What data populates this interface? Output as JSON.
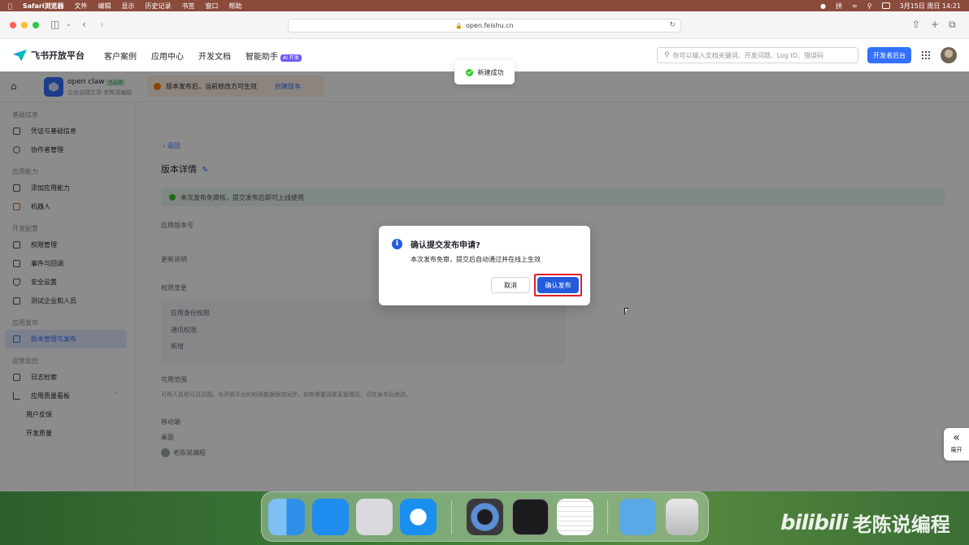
{
  "menubar": {
    "items": [
      "Safari浏览器",
      "文件",
      "编辑",
      "显示",
      "历史记录",
      "书签",
      "窗口",
      "帮助"
    ],
    "input_method": "拼",
    "datetime": "3月15日 周日 14:21"
  },
  "browser": {
    "url": "open.feishu.cn"
  },
  "topnav": {
    "brand": "飞书开放平台",
    "items": [
      "客户案例",
      "应用中心",
      "开发文档",
      "智能助手"
    ],
    "ai_badge": "AI 开发",
    "search_placeholder": "你可以输入文档关键词、开发问题、Log ID、错误码",
    "dev_console": "开发者后台"
  },
  "app_header": {
    "app_name": "open claw",
    "app_status": "已启用",
    "app_sub": "企业自建应用·老陈说编程",
    "notice": "版本发布后，当前修改方可生效",
    "notice_link": "创建版本"
  },
  "sidebar": {
    "groups": [
      {
        "title": "基础信息",
        "items": [
          "凭证与基础信息",
          "协作者管理"
        ]
      },
      {
        "title": "应用能力",
        "items": [
          "添加应用能力",
          "机器人"
        ]
      },
      {
        "title": "开发配置",
        "items": [
          "权限管理",
          "事件与回调",
          "安全设置",
          "测试企业和人员"
        ]
      },
      {
        "title": "应用发布",
        "items": [
          "版本管理与发布"
        ]
      },
      {
        "title": "运营监控",
        "items": [
          "日志检索",
          "应用质量看板"
        ]
      }
    ],
    "sub_items": [
      "用户反馈",
      "开发质量"
    ]
  },
  "main": {
    "back": "返回",
    "title": "版本详情",
    "success": "本次发布免审核，提交发布后即可上线使用",
    "fields": [
      "应用版本号",
      "更新说明",
      "权限变更"
    ],
    "perms": [
      "应用身份权限",
      "通讯权限",
      "新增"
    ],
    "visibility_title": "可用范围",
    "long_text": "可用人员和可见范围，与开放平台的权限数据保持同步，如有需要请联系管理员，可在发布后修改。",
    "extra_fields": [
      "移动端",
      "桌面"
    ],
    "owner": "老陈说编程"
  },
  "toast": {
    "text": "新建成功"
  },
  "modal": {
    "title": "确认提交发布申请?",
    "desc": "本次发布免审，提交后自动通过并在线上生效",
    "cancel": "取消",
    "confirm": "确认发布"
  },
  "expand": {
    "label": "展开"
  },
  "dock": {
    "apps": [
      "Finder",
      "App Store",
      "启动台",
      "Safari",
      "QuickTime",
      "终端",
      "文本编辑",
      "下载",
      "废纸篓"
    ]
  },
  "watermark": {
    "logo": "bilibili",
    "text": "老陈说编程"
  }
}
